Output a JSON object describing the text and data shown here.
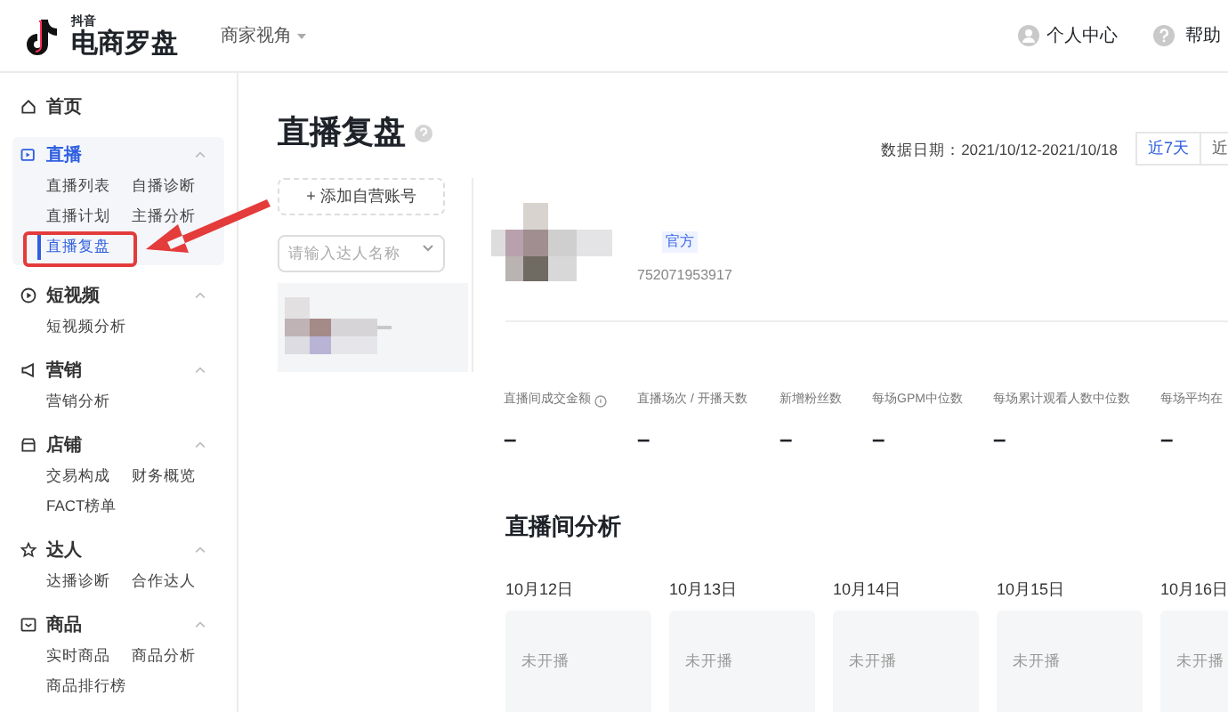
{
  "header": {
    "logo_small": "抖音",
    "logo": "电商罗盘",
    "view_switch": "商家视角",
    "user_link": "个人中心",
    "help_link": "帮助"
  },
  "sidebar": {
    "items": [
      {
        "label": "首页",
        "selected": false
      },
      {
        "label": "直播",
        "selected": true,
        "expanded": true,
        "children": [
          {
            "label": "直播列表",
            "selected": false
          },
          {
            "label": "自播诊断",
            "selected": false
          },
          {
            "label": "直播计划",
            "selected": false
          },
          {
            "label": "主播分析",
            "selected": false
          },
          {
            "label": "直播复盘",
            "selected": true
          }
        ]
      },
      {
        "label": "短视频",
        "selected": false,
        "expanded": true,
        "children": [
          {
            "label": "短视频分析",
            "selected": false
          }
        ]
      },
      {
        "label": "营销",
        "selected": false,
        "expanded": true,
        "children": [
          {
            "label": "营销分析",
            "selected": false
          }
        ]
      },
      {
        "label": "店铺",
        "selected": false,
        "expanded": true,
        "children": [
          {
            "label": "交易构成",
            "selected": false
          },
          {
            "label": "财务概览",
            "selected": false
          },
          {
            "label": "FACT榜单",
            "selected": false
          }
        ]
      },
      {
        "label": "达人",
        "selected": false,
        "expanded": true,
        "children": [
          {
            "label": "达播诊断",
            "selected": false
          },
          {
            "label": "合作达人",
            "selected": false
          }
        ]
      },
      {
        "label": "商品",
        "selected": false,
        "expanded": true,
        "children": [
          {
            "label": "实时商品",
            "selected": false
          },
          {
            "label": "商品分析",
            "selected": false
          },
          {
            "label": "商品排行榜",
            "selected": false
          }
        ]
      }
    ]
  },
  "page": {
    "title": "直播复盘",
    "add_account_button": "+ 添加自营账号",
    "search": {
      "placeholder": "请输入达人名称"
    },
    "account": {
      "badge": "官方",
      "id": "752071953917"
    },
    "date_range": "数据日期：2021/10/12-2021/10/18",
    "range_tabs": [
      {
        "label": "近7天",
        "selected": true
      },
      {
        "label": "近",
        "selected": false
      }
    ],
    "stats": [
      {
        "label": "直播间成交金额",
        "help": true,
        "value": "–"
      },
      {
        "label": "直播场次 / 开播天数",
        "help": false,
        "value": "–"
      },
      {
        "label": "新增粉丝数",
        "help": false,
        "value": "–"
      },
      {
        "label": "每场GPM中位数",
        "help": false,
        "value": "–"
      },
      {
        "label": "每场累计观看人数中位数",
        "help": false,
        "value": "–"
      },
      {
        "label": "每场平均在",
        "help": false,
        "value": "–"
      }
    ],
    "analysis_title": "直播间分析",
    "days": [
      {
        "date": "10月12日",
        "status": "未开播"
      },
      {
        "date": "10月13日",
        "status": "未开播"
      },
      {
        "date": "10月14日",
        "status": "未开播"
      },
      {
        "date": "10月15日",
        "status": "未开播"
      },
      {
        "date": "10月16日",
        "status": "未开播"
      }
    ]
  }
}
